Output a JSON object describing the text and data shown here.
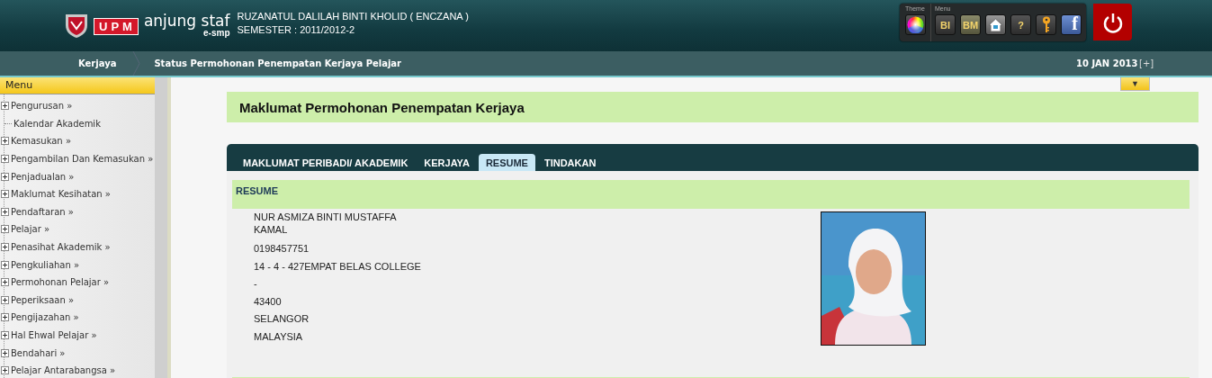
{
  "header": {
    "logo": {
      "mark": "UPM",
      "name": "anjung staf",
      "sub": "e-smp"
    },
    "user": "RUZANATUL DALILAH BINTI KHOLID ( ENCZANA )",
    "semester": "SEMESTER : 2011/2012-2",
    "theme_label": "Theme",
    "menu_label": "Menu",
    "tools": [
      {
        "kind": "text",
        "label": "BI"
      },
      {
        "kind": "text",
        "label": "BM"
      },
      {
        "kind": "home"
      },
      {
        "kind": "text",
        "label": "?"
      },
      {
        "kind": "key"
      },
      {
        "kind": "facebook",
        "label": "f"
      }
    ]
  },
  "breadcrumb": [
    "Kerjaya",
    "Status Permohonan Penempatan Kerjaya Pelajar"
  ],
  "date": "10 JAN 2013",
  "expand_toggle": "[+]",
  "sidebar": {
    "title": "Menu",
    "items": [
      {
        "label": "Pengurusan »",
        "kind": "branch"
      },
      {
        "label": "Kalendar Akademik",
        "kind": "leaf"
      },
      {
        "label": "Kemasukan »",
        "kind": "branch"
      },
      {
        "label": "Pengambilan Dan Kemasukan »",
        "kind": "branch"
      },
      {
        "label": "Penjadualan »",
        "kind": "branch"
      },
      {
        "label": "Maklumat Kesihatan »",
        "kind": "branch"
      },
      {
        "label": "Pendaftaran »",
        "kind": "branch"
      },
      {
        "label": "Pelajar »",
        "kind": "branch"
      },
      {
        "label": "Penasihat Akademik »",
        "kind": "branch"
      },
      {
        "label": "Pengkuliahan »",
        "kind": "branch"
      },
      {
        "label": "Permohonan Pelajar »",
        "kind": "branch"
      },
      {
        "label": "Peperiksaan »",
        "kind": "branch"
      },
      {
        "label": "Pengijazahan »",
        "kind": "branch"
      },
      {
        "label": "Hal Ehwal Pelajar »",
        "kind": "branch"
      },
      {
        "label": "Bendahari »",
        "kind": "branch"
      },
      {
        "label": "Pelajar Antarabangsa »",
        "kind": "branch"
      }
    ]
  },
  "collapse_toggle": "▼",
  "page_title": "Maklumat Permohonan Penempatan Kerjaya",
  "tabs": [
    {
      "label": "MAKLUMAT PERIBADI/ AKADEMIK",
      "selected": false
    },
    {
      "label": "KERJAYA",
      "selected": false
    },
    {
      "label": "RESUME",
      "selected": true
    },
    {
      "label": "TINDAKAN",
      "selected": false
    }
  ],
  "section_title": "RESUME",
  "resume": {
    "lines": [
      "NUR ASMIZA BINTI MUSTAFFA KAMAL",
      "0198457751",
      "14 - 4 - 427EMPAT BELAS COLLEGE",
      "-",
      "43400",
      "SELANGOR",
      "MALAYSIA"
    ]
  }
}
